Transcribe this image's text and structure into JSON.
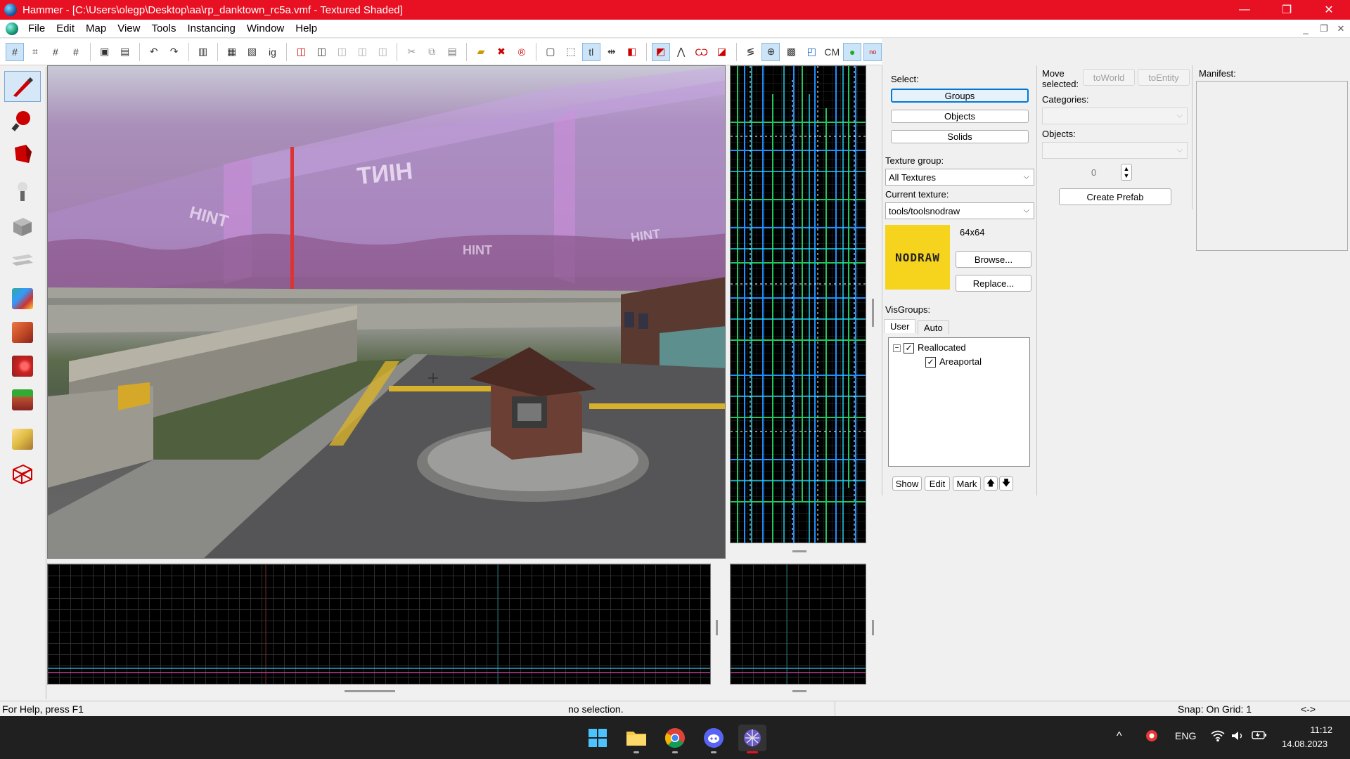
{
  "window": {
    "title": "Hammer - [C:\\Users\\olegp\\Desktop\\aa\\rp_danktown_rc5a.vmf - Textured Shaded]",
    "minimize": "—",
    "restore": "❐",
    "close": "✕"
  },
  "menu": {
    "items": [
      "File",
      "Edit",
      "Map",
      "View",
      "Tools",
      "Instancing",
      "Window",
      "Help"
    ]
  },
  "toolbar": {
    "cm_label": "CM"
  },
  "viewport3d": {
    "hint_text": "HINT"
  },
  "select_panel": {
    "select_label": "Select:",
    "groups": "Groups",
    "objects": "Objects",
    "solids": "Solids",
    "texture_group_label": "Texture group:",
    "texture_group_value": "All Textures",
    "current_texture_label": "Current texture:",
    "current_texture_value": "tools/toolsnodraw",
    "texture_preview_text": "NODRAW",
    "texture_size": "64x64",
    "browse": "Browse...",
    "replace": "Replace...",
    "visgroups_label": "VisGroups:",
    "tab_user": "User",
    "tab_auto": "Auto",
    "tree": [
      {
        "label": "Reallocated",
        "checked": true
      },
      {
        "label": "Areaportal",
        "checked": true
      }
    ],
    "show": "Show",
    "edit": "Edit",
    "mark": "Mark"
  },
  "move_panel": {
    "move_selected_label": "Move selected:",
    "to_world": "toWorld",
    "to_entity": "toEntity",
    "categories_label": "Categories:",
    "objects_label": "Objects:",
    "spinner_value": "0",
    "create_prefab": "Create Prefab"
  },
  "manifest_panel": {
    "label": "Manifest:"
  },
  "status": {
    "help": "For Help, press F1",
    "selection": "no selection.",
    "snap": "Snap: On Grid: 1",
    "arrows": "<->"
  },
  "taskbar": {
    "language": "ENG",
    "time": "11:12",
    "date": "14.08.2023"
  },
  "colors": {
    "titlebar": "#e81123",
    "nodraw": "#f6d31c",
    "selection_blue": "#0078d7"
  }
}
